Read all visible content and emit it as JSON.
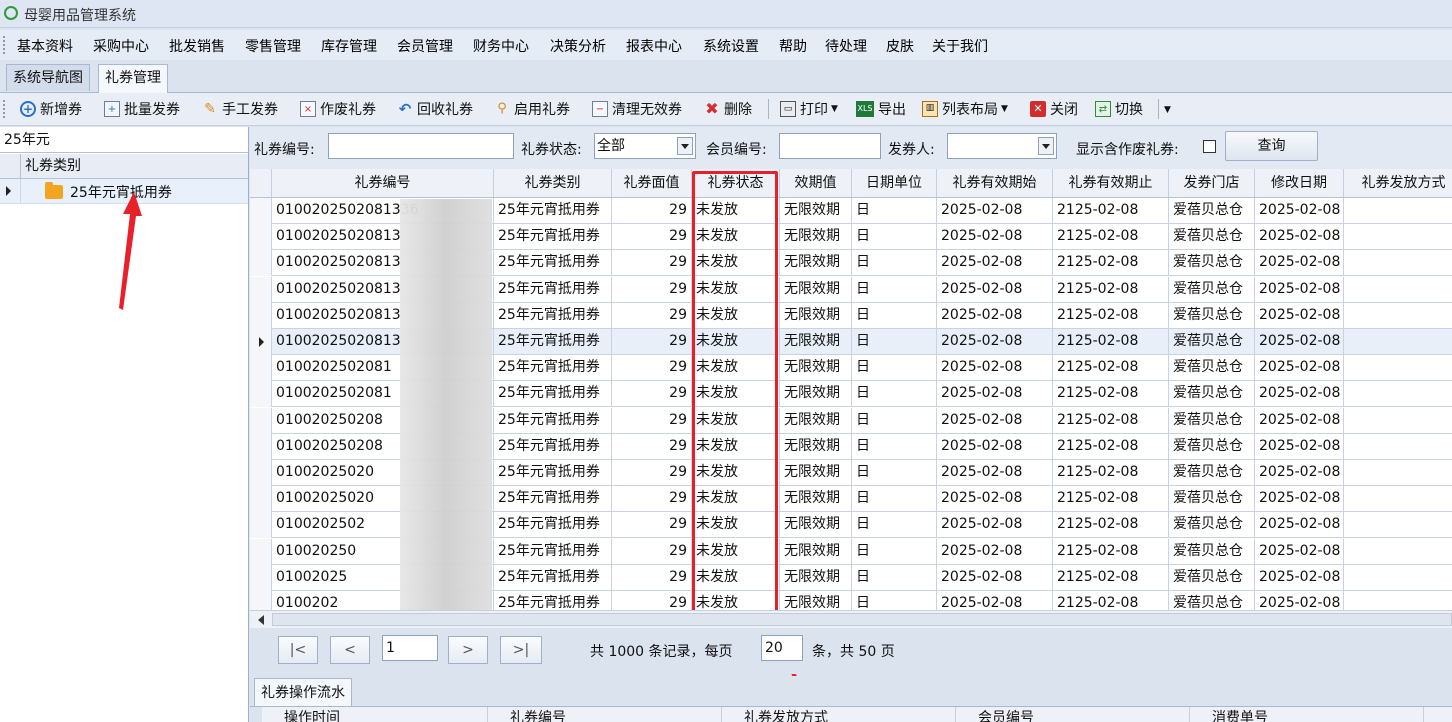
{
  "app": {
    "title": "母婴用品管理系统"
  },
  "menu": [
    "基本资料",
    "采购中心",
    "批发销售",
    "零售管理",
    "库存管理",
    "会员管理",
    "财务中心",
    "决策分析",
    "报表中心",
    "系统设置",
    "帮助",
    "待处理",
    "皮肤",
    "关于我们"
  ],
  "tabs": [
    {
      "label": "系统导航图"
    },
    {
      "label": "礼券管理"
    }
  ],
  "toolbar": {
    "new": "新增券",
    "batch": "批量发券",
    "manual": "手工发券",
    "void": "作废礼券",
    "recycle": "回收礼券",
    "enable": "启用礼券",
    "clear": "清理无效券",
    "delete": "删除",
    "print": "打印",
    "export": "导出",
    "layout": "列表布局",
    "close": "关闭",
    "switch": "切换"
  },
  "left": {
    "search_value": "25年元",
    "header": "礼券类别",
    "items": [
      {
        "label": "25年元宵抵用券"
      }
    ]
  },
  "filter": {
    "code_label": "礼券编号:",
    "code_value": "",
    "status_label": "礼券状态:",
    "status_value": "全部",
    "member_label": "会员编号:",
    "member_value": "",
    "issuer_label": "发券人:",
    "issuer_value": "",
    "show_void_label": "显示含作废礼券:",
    "query_button": "查询"
  },
  "grid": {
    "columns": [
      "礼券编号",
      "礼券类别",
      "礼券面值",
      "礼券状态",
      "效期值",
      "日期单位",
      "礼券有效期始",
      "礼券有效期止",
      "发券门店",
      "修改日期",
      "礼券发放方式"
    ],
    "rows": [
      {
        "code": "0100202502081336",
        "cat": "25年元宵抵用券",
        "val": "29",
        "status": "未发放",
        "term": "无限效期",
        "unit": "日",
        "start": "2025-02-08",
        "end": "2125-02-08",
        "store": "爱蓓贝总仓",
        "mod": "2025-02-08"
      },
      {
        "code": "01002025020813",
        "cat": "25年元宵抵用券",
        "val": "29",
        "status": "未发放",
        "term": "无限效期",
        "unit": "日",
        "start": "2025-02-08",
        "end": "2125-02-08",
        "store": "爱蓓贝总仓",
        "mod": "2025-02-08"
      },
      {
        "code": "01002025020813",
        "cat": "25年元宵抵用券",
        "val": "29",
        "status": "未发放",
        "term": "无限效期",
        "unit": "日",
        "start": "2025-02-08",
        "end": "2125-02-08",
        "store": "爱蓓贝总仓",
        "mod": "2025-02-08"
      },
      {
        "code": "01002025020813",
        "cat": "25年元宵抵用券",
        "val": "29",
        "status": "未发放",
        "term": "无限效期",
        "unit": "日",
        "start": "2025-02-08",
        "end": "2125-02-08",
        "store": "爱蓓贝总仓",
        "mod": "2025-02-08"
      },
      {
        "code": "01002025020813",
        "cat": "25年元宵抵用券",
        "val": "29",
        "status": "未发放",
        "term": "无限效期",
        "unit": "日",
        "start": "2025-02-08",
        "end": "2125-02-08",
        "store": "爱蓓贝总仓",
        "mod": "2025-02-08"
      },
      {
        "code": "01002025020813",
        "cat": "25年元宵抵用券",
        "val": "29",
        "status": "未发放",
        "term": "无限效期",
        "unit": "日",
        "start": "2025-02-08",
        "end": "2125-02-08",
        "store": "爱蓓贝总仓",
        "mod": "2025-02-08"
      },
      {
        "code": "0100202502081",
        "cat": "25年元宵抵用券",
        "val": "29",
        "status": "未发放",
        "term": "无限效期",
        "unit": "日",
        "start": "2025-02-08",
        "end": "2125-02-08",
        "store": "爱蓓贝总仓",
        "mod": "2025-02-08"
      },
      {
        "code": "0100202502081",
        "cat": "25年元宵抵用券",
        "val": "29",
        "status": "未发放",
        "term": "无限效期",
        "unit": "日",
        "start": "2025-02-08",
        "end": "2125-02-08",
        "store": "爱蓓贝总仓",
        "mod": "2025-02-08"
      },
      {
        "code": "010020250208",
        "cat": "25年元宵抵用券",
        "val": "29",
        "status": "未发放",
        "term": "无限效期",
        "unit": "日",
        "start": "2025-02-08",
        "end": "2125-02-08",
        "store": "爱蓓贝总仓",
        "mod": "2025-02-08"
      },
      {
        "code": "010020250208",
        "cat": "25年元宵抵用券",
        "val": "29",
        "status": "未发放",
        "term": "无限效期",
        "unit": "日",
        "start": "2025-02-08",
        "end": "2125-02-08",
        "store": "爱蓓贝总仓",
        "mod": "2025-02-08"
      },
      {
        "code": "01002025020",
        "cat": "25年元宵抵用券",
        "val": "29",
        "status": "未发放",
        "term": "无限效期",
        "unit": "日",
        "start": "2025-02-08",
        "end": "2125-02-08",
        "store": "爱蓓贝总仓",
        "mod": "2025-02-08"
      },
      {
        "code": "01002025020",
        "cat": "25年元宵抵用券",
        "val": "29",
        "status": "未发放",
        "term": "无限效期",
        "unit": "日",
        "start": "2025-02-08",
        "end": "2125-02-08",
        "store": "爱蓓贝总仓",
        "mod": "2025-02-08"
      },
      {
        "code": "0100202502",
        "cat": "25年元宵抵用券",
        "val": "29",
        "status": "未发放",
        "term": "无限效期",
        "unit": "日",
        "start": "2025-02-08",
        "end": "2125-02-08",
        "store": "爱蓓贝总仓",
        "mod": "2025-02-08"
      },
      {
        "code": "010020250",
        "cat": "25年元宵抵用券",
        "val": "29",
        "status": "未发放",
        "term": "无限效期",
        "unit": "日",
        "start": "2025-02-08",
        "end": "2125-02-08",
        "store": "爱蓓贝总仓",
        "mod": "2025-02-08"
      },
      {
        "code": "01002025",
        "cat": "25年元宵抵用券",
        "val": "29",
        "status": "未发放",
        "term": "无限效期",
        "unit": "日",
        "start": "2025-02-08",
        "end": "2125-02-08",
        "store": "爱蓓贝总仓",
        "mod": "2025-02-08"
      },
      {
        "code": "0100202",
        "cat": "25年元宵抵用券",
        "val": "29",
        "status": "未发放",
        "term": "无限效期",
        "unit": "日",
        "start": "2025-02-08",
        "end": "2125-02-08",
        "store": "爱蓓贝总仓",
        "mod": "2025-02-08"
      }
    ],
    "selected_index": 5
  },
  "pager": {
    "page_value": "1",
    "first": "|<",
    "prev": "<",
    "next": ">",
    "last": ">|",
    "text1": "共 1000 条记录，每页",
    "per_page": "20",
    "text2": "条，共 50 页"
  },
  "bottom": {
    "tab": "礼券操作流水",
    "columns": [
      "操作时间",
      "礼券编号",
      "礼券发放方式",
      "会员编号",
      "消费单号"
    ]
  },
  "colors": {
    "highlight": "#e8202a",
    "folder": "#f3a520"
  }
}
